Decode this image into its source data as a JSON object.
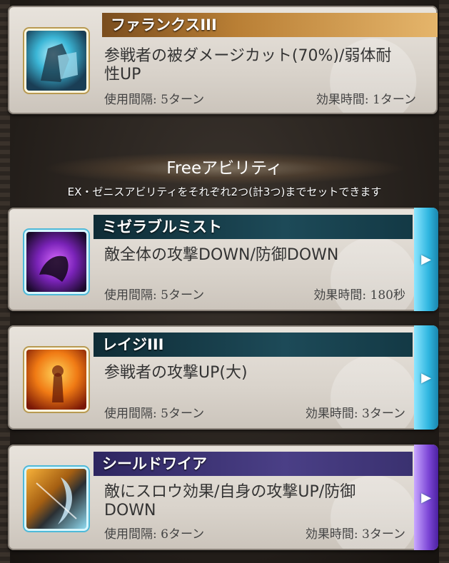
{
  "cards": [
    {
      "name": "ファランクスIII",
      "description": "参戦者の被ダメージカット(70%)/弱体耐性UP",
      "cooldown": "使用間隔: 5ターン",
      "duration": "効果時間: 1ターン",
      "icon": "shield-knight-icon",
      "accent": "#b97f35"
    },
    {
      "name": "ミゼラブルミスト",
      "description": "敵全体の攻撃DOWN/防御DOWN",
      "cooldown": "使用間隔: 5ターン",
      "duration": "効果時間: 180秒",
      "icon": "mist-icon",
      "accent": "#1d4a58"
    },
    {
      "name": "レイジIII",
      "description": "参戦者の攻撃UP(大)",
      "cooldown": "使用間隔: 5ターン",
      "duration": "効果時間: 3ターン",
      "icon": "rage-icon",
      "accent": "#1d4a58"
    },
    {
      "name": "シールドワイア",
      "description": "敵にスロウ効果/自身の攻撃UP/防御DOWN",
      "cooldown": "使用間隔: 6ターン",
      "duration": "効果時間: 3ターン",
      "icon": "shield-wire-icon",
      "accent": "#4a3f86"
    }
  ],
  "free_section": {
    "title": "Freeアビリティ",
    "note": "EX・ゼニスアビリティをそれぞれ2つ(計3つ)までセットできます"
  },
  "arrow_glyph": "▶"
}
